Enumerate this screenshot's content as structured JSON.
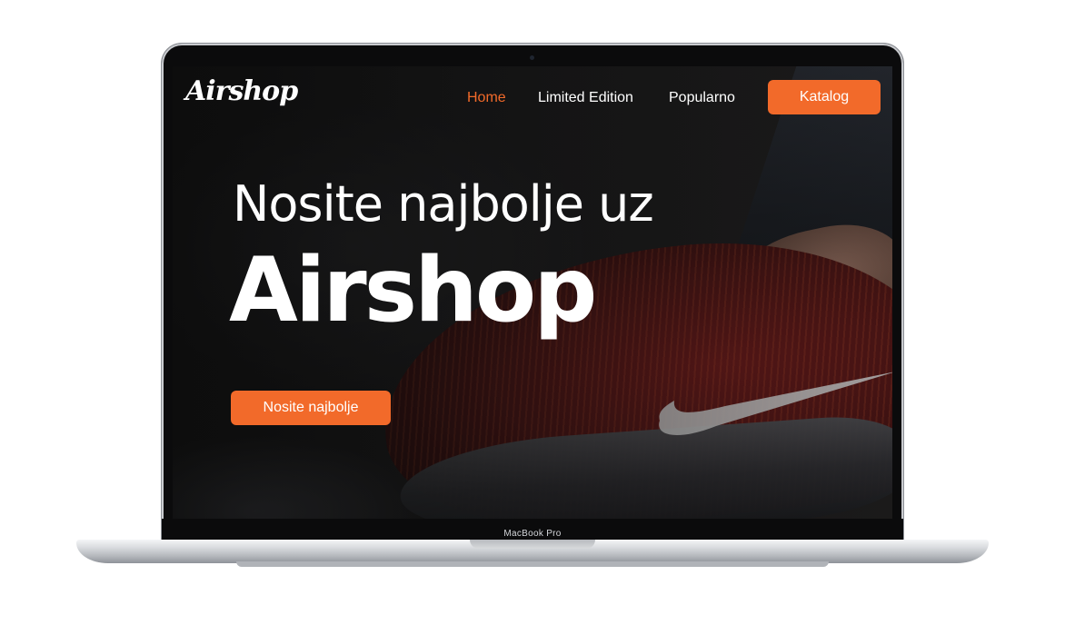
{
  "device": {
    "model_label": "MacBook Pro"
  },
  "site": {
    "logo": "Airshop",
    "nav": [
      {
        "label": "Home",
        "active": true
      },
      {
        "label": "Limited Edition",
        "active": false
      },
      {
        "label": "Popularno",
        "active": false
      }
    ],
    "catalog_button": "Katalog"
  },
  "hero": {
    "headline": "Nosite najbolje uz",
    "brand": "Airshop",
    "cta_label": "Nosite najbolje"
  },
  "colors": {
    "accent": "#f26a2a",
    "text": "#ffffff"
  }
}
